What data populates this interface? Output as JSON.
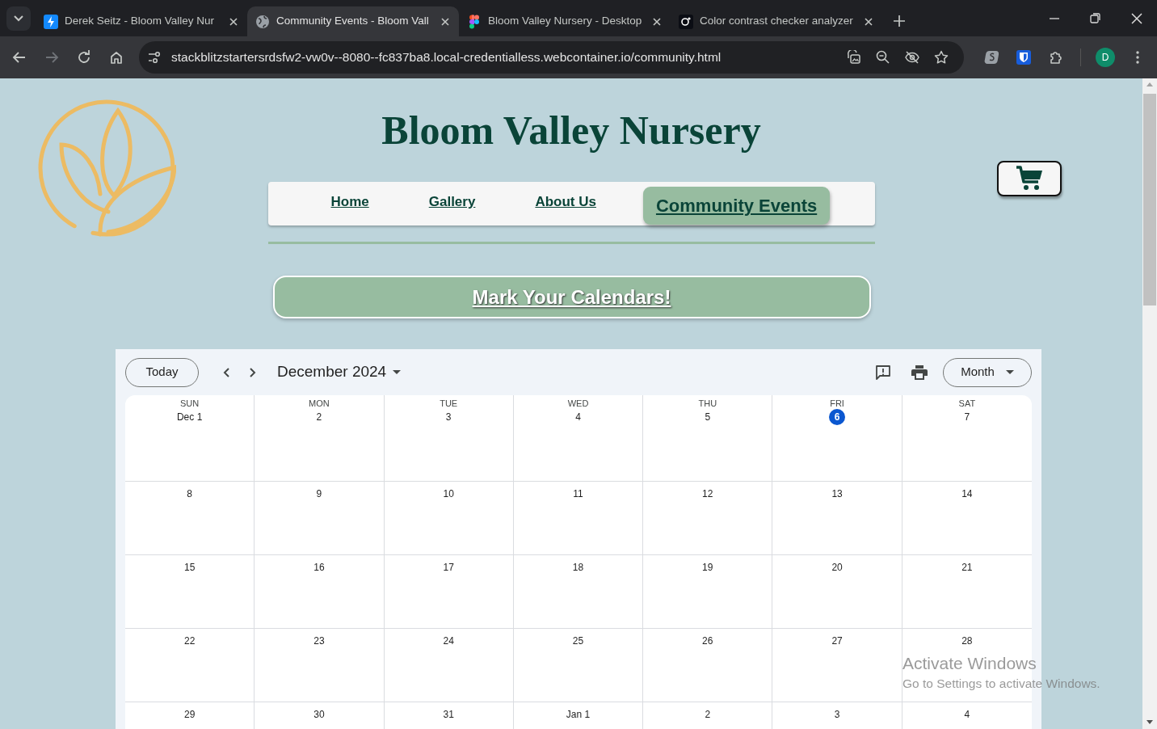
{
  "browser": {
    "tabs": [
      {
        "kind": "bolt",
        "title": "Derek Seitz - Bloom Valley Nur",
        "selected": false
      },
      {
        "kind": "globe",
        "title": "Community Events - Bloom Vall",
        "selected": true
      },
      {
        "kind": "figma",
        "title": "Bloom Valley Nursery - Desktop",
        "selected": false
      },
      {
        "kind": "contrast",
        "title": "Color contrast checker analyzer",
        "selected": false
      }
    ],
    "url": "stackblitzstartersrdsfw2-vw0v--8080--fc837ba8.local-credentialless.webcontainer.io/community.html",
    "profile_initial": "D"
  },
  "site": {
    "title": "Bloom Valley Nursery",
    "nav": [
      {
        "label": "Home",
        "selected": false
      },
      {
        "label": "Gallery",
        "selected": false
      },
      {
        "label": "About Us",
        "selected": false
      },
      {
        "label": "Community Events",
        "selected": true
      }
    ],
    "banner": "Mark Your Calendars!"
  },
  "calendar": {
    "today_button": "Today",
    "month_label": "December 2024",
    "view_button": "Month",
    "weekdays": [
      "SUN",
      "MON",
      "TUE",
      "WED",
      "THU",
      "FRI",
      "SAT"
    ],
    "weeks": [
      [
        {
          "date": "Dec 1",
          "today": false
        },
        {
          "date": "2",
          "today": false
        },
        {
          "date": "3",
          "today": false
        },
        {
          "date": "4",
          "today": false
        },
        {
          "date": "5",
          "today": false
        },
        {
          "date": "6",
          "today": true
        },
        {
          "date": "7",
          "today": false
        }
      ],
      [
        {
          "date": "8",
          "today": false
        },
        {
          "date": "9",
          "today": false
        },
        {
          "date": "10",
          "today": false
        },
        {
          "date": "11",
          "today": false
        },
        {
          "date": "12",
          "today": false
        },
        {
          "date": "13",
          "today": false
        },
        {
          "date": "14",
          "today": false
        }
      ],
      [
        {
          "date": "15",
          "today": false
        },
        {
          "date": "16",
          "today": false
        },
        {
          "date": "17",
          "today": false
        },
        {
          "date": "18",
          "today": false
        },
        {
          "date": "19",
          "today": false
        },
        {
          "date": "20",
          "today": false
        },
        {
          "date": "21",
          "today": false
        }
      ],
      [
        {
          "date": "22",
          "today": false
        },
        {
          "date": "23",
          "today": false
        },
        {
          "date": "24",
          "today": false
        },
        {
          "date": "25",
          "today": false
        },
        {
          "date": "26",
          "today": false
        },
        {
          "date": "27",
          "today": false
        },
        {
          "date": "28",
          "today": false
        }
      ],
      [
        {
          "date": "29",
          "today": false
        },
        {
          "date": "30",
          "today": false
        },
        {
          "date": "31",
          "today": false
        },
        {
          "date": "Jan 1",
          "today": false
        },
        {
          "date": "2",
          "today": false
        },
        {
          "date": "3",
          "today": false
        },
        {
          "date": "4",
          "today": false
        }
      ]
    ]
  },
  "os_overlay": {
    "title": "Activate Windows",
    "message": "Go to Settings to activate Windows."
  }
}
